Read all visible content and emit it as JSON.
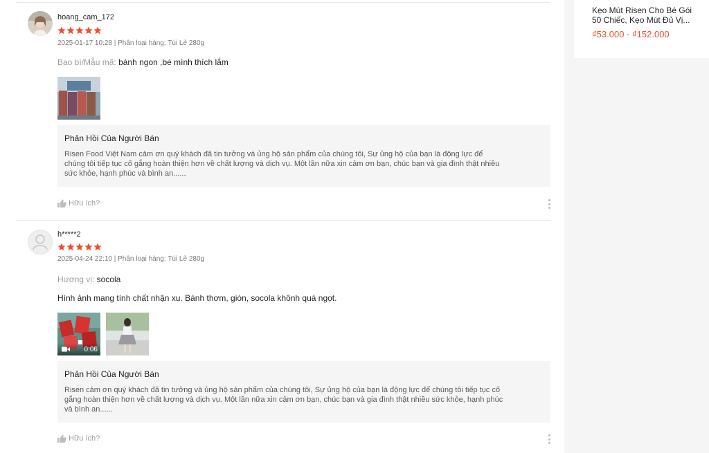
{
  "reviews": [
    {
      "username": "hoang_cam_172",
      "rating": 5,
      "datetime": "2025-01-17 10:28",
      "separator": "|",
      "variation_label": "Phân loại hàng:",
      "variation_value": "Túi Lẻ 280g",
      "attribute_key": "Bao bì/Mẫu mã:",
      "attribute_value": "bánh ngon ,bé mình thích lắm",
      "comment": "",
      "media": [
        {
          "type": "image"
        }
      ],
      "seller_reply": {
        "title": "Phản Hồi Của Người Bán",
        "lines": [
          "Risen Food Việt Nam cảm ơn quý khách đã tin tưởng và ủng hộ sản phẩm của chúng tôi, Sự ủng hộ của bạn là động lực để",
          "chúng tôi tiếp tục cố gắng hoàn thiện hơn về chất lượng và dịch vụ. Một lần nữa xin cảm ơn bạn, chúc bạn và gia đình thật nhiều",
          "sức khỏe, hạnh phúc và bình an......"
        ]
      },
      "helpful_label": "Hữu ích?"
    },
    {
      "username": "h*****2",
      "rating": 5,
      "datetime": "2025-04-24 22:10",
      "separator": "|",
      "variation_label": "Phân loại hàng:",
      "variation_value": "Túi Lẻ 280g",
      "attribute_key": "Hương vị:",
      "attribute_value": "socola",
      "comment": "Hình ảnh mang tính chất nhận xu. Bánh thơm, giòn, socola khônh quá ngọt.",
      "media": [
        {
          "type": "video",
          "duration": "0:06"
        },
        {
          "type": "image"
        }
      ],
      "seller_reply": {
        "title": "Phản Hồi Của Người Bán",
        "lines": [
          "Risen cảm ơn quý khách đã tin tưởng và ủng hộ sản phẩm của chúng tôi, Sự ủng hộ của bạn là động lực để chúng tôi tiếp tục cố",
          "gắng hoàn thiện hơn về chất lượng và dịch vụ. Một lần nữa xin cảm ơn bạn, chúc bạn và gia đình thật nhiều sức khỏe, hạnh phúc",
          "và bình an......"
        ]
      },
      "helpful_label": "Hữu ích?"
    }
  ],
  "side_product": {
    "title_line1": "Kẹo Mút Risen Cho Bé Gói",
    "title_line2": "50 Chiếc, Kẹo Mút Đủ Vị...",
    "price": "₫53.000 - ₫152.000"
  },
  "colors": {
    "accent": "#ee4d2d",
    "star": "#ee4d2d",
    "reply_bg": "#f5f5f5",
    "page_bg": "#f5f5f5"
  },
  "icons": {
    "star": "star-icon",
    "thumb": "thumbs-up-icon",
    "more": "more-vertical-icon",
    "video": "video-camera-icon",
    "default_avatar": "user-icon"
  }
}
